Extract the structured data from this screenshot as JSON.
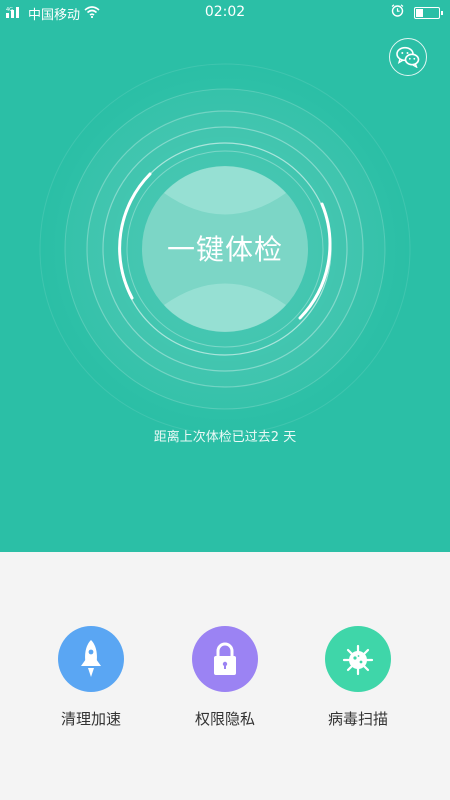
{
  "status_bar": {
    "carrier": "中国移动",
    "time": "02:02"
  },
  "battery_level": 0.35,
  "main": {
    "check_label": "一键体检",
    "last_check_text": "距离上次体检已过去2 天"
  },
  "tools": [
    {
      "label": "清理加速",
      "icon": "rocket-icon",
      "color": "#5aa6f3"
    },
    {
      "label": "权限隐私",
      "icon": "lock-icon",
      "color": "#9b83f3"
    },
    {
      "label": "病毒扫描",
      "icon": "virus-icon",
      "color": "#3fd6a9"
    }
  ],
  "colors": {
    "primary": "#2bbfa6",
    "background": "#f4f4f4"
  },
  "icons": {
    "wechat": "wechat-icon",
    "signal": "signal-icon",
    "wifi": "wifi-icon",
    "alarm": "alarm-icon",
    "battery": "battery-icon"
  }
}
